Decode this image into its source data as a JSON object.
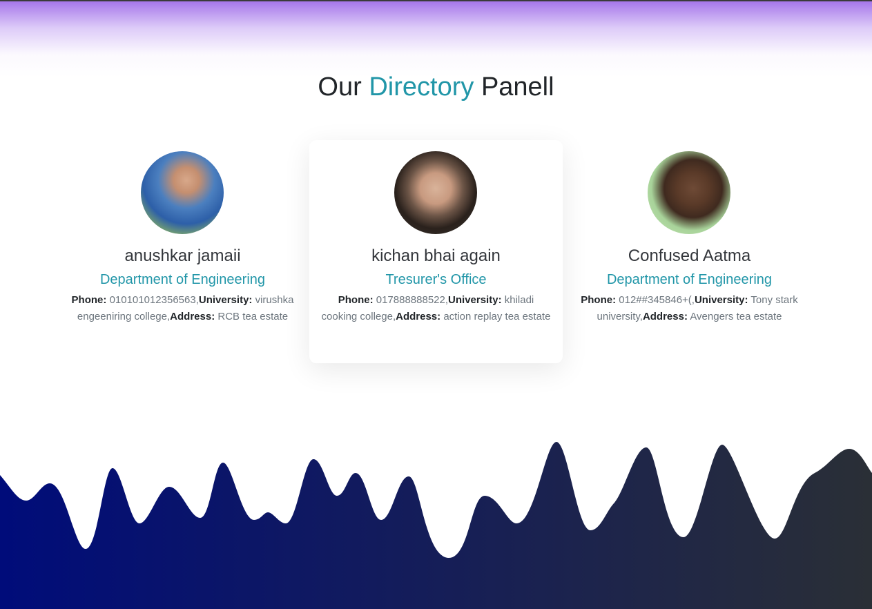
{
  "header": {
    "title_part1": "Our",
    "title_accent": "Directory",
    "title_part2": "Panell"
  },
  "colors": {
    "accent": "#2196a8",
    "wave_start": "#000c7a",
    "wave_end": "#2a2f36",
    "glow": "#965fe6"
  },
  "panel": {
    "members": [
      {
        "name": "anushkar jamaii",
        "department": "Department of Engineering",
        "phone_label": "Phone:",
        "phone": "010101012356563,",
        "university_label": "University:",
        "university": "virushka engeeniring college,",
        "address_label": "Address:",
        "address": "RCB tea estate"
      },
      {
        "name": "kichan bhai again",
        "department": "Tresurer's Office",
        "phone_label": "Phone:",
        "phone": "017888888522,",
        "university_label": "University:",
        "university": "khiladi cooking college,",
        "address_label": "Address:",
        "address": "action replay tea estate"
      },
      {
        "name": "Confused Aatma",
        "department": "Department of Engineering",
        "phone_label": "Phone:",
        "phone": "012##345846+(,",
        "university_label": "University:",
        "university": "Tony stark university,",
        "address_label": "Address:",
        "address": "Avengers tea estate"
      }
    ]
  }
}
